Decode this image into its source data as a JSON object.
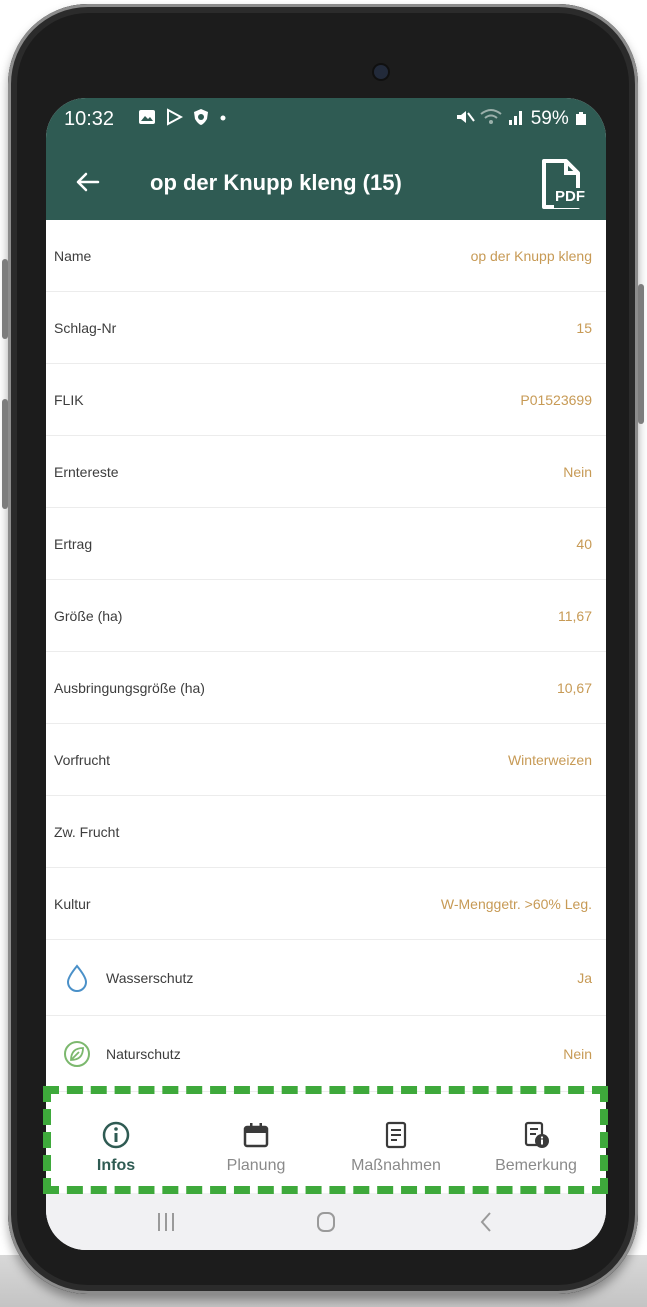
{
  "status_bar": {
    "time": "10:32",
    "notification_icons": [
      "gallery-icon",
      "play-store-icon",
      "shield-icon",
      "dot"
    ],
    "right_text": "59%",
    "right_icons": [
      "mute-icon",
      "wifi-icon",
      "signal-icon",
      "battery-icon"
    ]
  },
  "app_bar": {
    "title": "op der Knupp kleng (15)",
    "pdf_label": "PDF",
    "color": "#2f5b53"
  },
  "fields": [
    {
      "label": "Name",
      "value": "op der Knupp kleng"
    },
    {
      "label": "Schlag-Nr",
      "value": "15"
    },
    {
      "label": "FLIK",
      "value": "P01523699"
    },
    {
      "label": "Erntereste",
      "value": "Nein"
    },
    {
      "label": "Ertrag",
      "value": "40"
    },
    {
      "label": "Größe (ha)",
      "value": "11,67"
    },
    {
      "label": "Ausbringungsgröße (ha)",
      "value": "10,67"
    },
    {
      "label": "Vorfrucht",
      "value": "Winterweizen"
    },
    {
      "label": "Zw. Frucht",
      "value": ""
    },
    {
      "label": "Kultur",
      "value": "W-Menggetr. >60% Leg."
    }
  ],
  "protection": [
    {
      "icon": "water-drop-icon",
      "label": "Wasserschutz",
      "value": "Ja"
    },
    {
      "icon": "leaf-icon",
      "label": "Naturschutz",
      "value": "Nein"
    }
  ],
  "bottom_nav": [
    {
      "icon": "info-icon",
      "label": "Infos",
      "active": true
    },
    {
      "icon": "calendar-icon",
      "label": "Planung",
      "active": false
    },
    {
      "icon": "document-icon",
      "label": "Maßnahmen",
      "active": false
    },
    {
      "icon": "document-info-icon",
      "label": "Bemerkung",
      "active": false
    }
  ],
  "colors": {
    "value_text": "#c79a55",
    "highlight_dash": "#3ea93b"
  }
}
